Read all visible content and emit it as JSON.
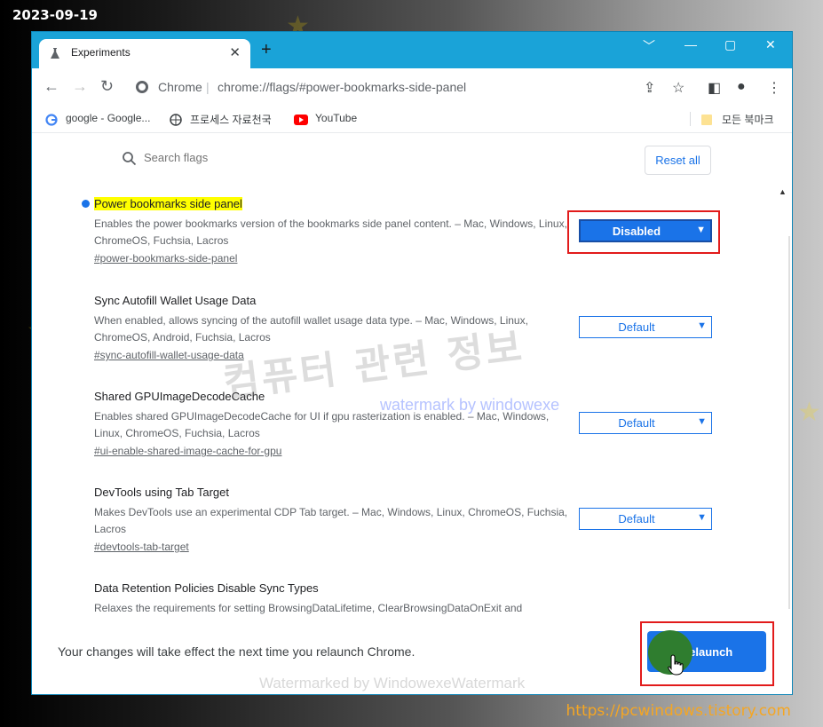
{
  "overlay": {
    "date": "2023-09-19",
    "site_url": "https://pcwindows.tistory.com",
    "watermark_korean": "컴퓨터 관련 정보",
    "watermark_by": "watermark by windowexe",
    "watermark_footer": "Watermarked by WindowexeWatermark"
  },
  "browser": {
    "tab_title": "Experiments",
    "omnibox_label": "Chrome",
    "omnibox_url": "chrome://flags/#power-bookmarks-side-panel"
  },
  "bookmarks": [
    {
      "label": "google - Google..."
    },
    {
      "label": "프로세스 자료천국"
    },
    {
      "label": "YouTube"
    },
    {
      "label": "모든 북마크"
    }
  ],
  "flags_page": {
    "search_placeholder": "Search flags",
    "reset_label": "Reset all",
    "flags": [
      {
        "name": "Power bookmarks side panel",
        "desc": "Enables the power bookmarks version of the bookmarks side panel content. – Mac, Windows, Linux, ChromeOS, Fuchsia, Lacros",
        "link": "#power-bookmarks-side-panel",
        "value": "Disabled"
      },
      {
        "name": "Sync Autofill Wallet Usage Data",
        "desc": "When enabled, allows syncing of the autofill wallet usage data type. – Mac, Windows, Linux, ChromeOS, Android, Fuchsia, Lacros",
        "link": "#sync-autofill-wallet-usage-data",
        "value": "Default"
      },
      {
        "name": "Shared GPUImageDecodeCache",
        "desc": "Enables shared GPUImageDecodeCache for UI if gpu rasterization is enabled. – Mac, Windows, Linux, ChromeOS, Fuchsia, Lacros",
        "link": "#ui-enable-shared-image-cache-for-gpu",
        "value": "Default"
      },
      {
        "name": "DevTools using Tab Target",
        "desc": "Makes DevTools use an experimental CDP Tab target. – Mac, Windows, Linux, ChromeOS, Fuchsia, Lacros",
        "link": "#devtools-tab-target",
        "value": "Default"
      },
      {
        "name": "Data Retention Policies Disable Sync Types",
        "desc": "Relaxes the requirements for setting BrowsingDataLifetime, ClearBrowsingDataOnExit and"
      }
    ]
  },
  "footer": {
    "message": "Your changes will take effect the next time you relaunch Chrome.",
    "relaunch_label": "Relaunch"
  }
}
